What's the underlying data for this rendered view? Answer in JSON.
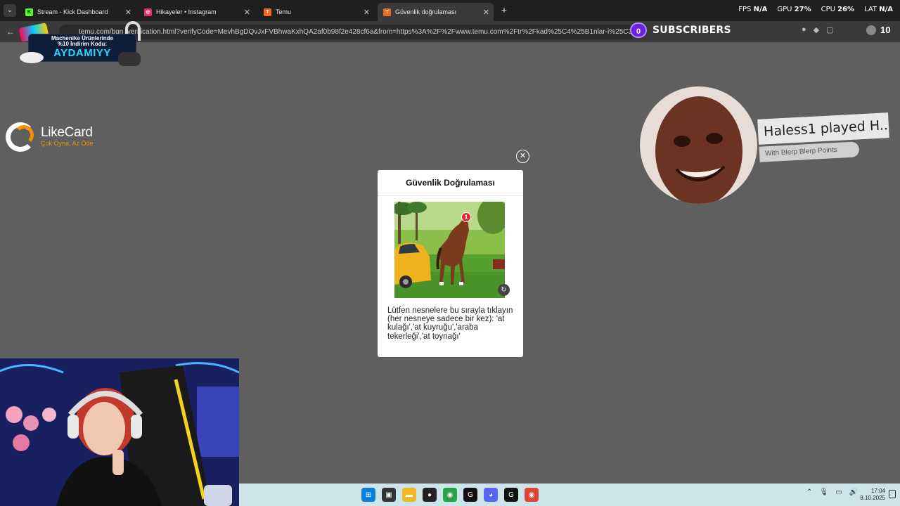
{
  "browser": {
    "tabs": [
      {
        "label": "Stream - Kick Dashboard",
        "icon": "kick-icon",
        "color": "#53fc18",
        "glyph": "K"
      },
      {
        "label": "Hikayeler • Instagram",
        "icon": "instagram-icon",
        "color": "#e1306c",
        "glyph": "◎"
      },
      {
        "label": "Temu",
        "icon": "temu-icon",
        "color": "#f56b1d",
        "glyph": "T"
      },
      {
        "label": "Güvenlik doğrulaması",
        "icon": "temu-icon",
        "color": "#f56b1d",
        "glyph": "T",
        "active": true
      }
    ],
    "url": "temu.com/bgn_verification.html?verifyCode=MevhBgDQvJxFVBhwaKxhQA2af0b98f2e428cf6a&from=https%3A%2F%2Fwww.temu.com%2Ftr%2Fkad%25C4%25B1nlar-i%25C3%25"
  },
  "stats": {
    "fps_label": "FPS",
    "fps_value": "N/A",
    "gpu_label": "GPU",
    "gpu_value": "27%",
    "cpu_label": "CPU",
    "cpu_value": "26%",
    "lat_label": "LAT",
    "lat_value": "N/A"
  },
  "subscribers": {
    "count": "0",
    "label": "SUBSCRIBERS"
  },
  "viewers": {
    "count": "10"
  },
  "promo": {
    "line1": "Machenike Ürünlerinde",
    "line2": "%10 İndirim Kodu:",
    "code": "AYDAMIYY"
  },
  "likecard": {
    "name": "LikeCard",
    "slogan": "Çok Oyna, Az Öde"
  },
  "captcha": {
    "title": "Güvenlik Doğrulaması",
    "marker": "1",
    "instruction": "Lütfen nesnelere bu sırayla tıklayın (her nesneye sadece bir kez): 'at kulağı','at kuyruğu','araba tekerleği','at toynağı'"
  },
  "alert": {
    "main": "Haless1 played H..",
    "sub": "With Blerp Blerp Points"
  },
  "taskbar": {
    "time": "17:04",
    "date": "8.10.2025",
    "apps": [
      {
        "name": "windows-start-icon",
        "color": "#0a7cd8",
        "glyph": "⊞"
      },
      {
        "name": "task-view-icon",
        "color": "#333",
        "glyph": "▣"
      },
      {
        "name": "file-explorer-icon",
        "color": "#f2b824",
        "glyph": "▬"
      },
      {
        "name": "obs-icon",
        "color": "#222",
        "glyph": "●"
      },
      {
        "name": "chrome-icon",
        "color": "#2d9f48",
        "glyph": "◉"
      },
      {
        "name": "app-g-icon",
        "color": "#111",
        "glyph": "G"
      },
      {
        "name": "discord-icon",
        "color": "#5865f2",
        "glyph": "◕"
      },
      {
        "name": "app-g2-icon",
        "color": "#111",
        "glyph": "G"
      },
      {
        "name": "chrome-icon-2",
        "color": "#db4437",
        "glyph": "◉"
      }
    ]
  }
}
